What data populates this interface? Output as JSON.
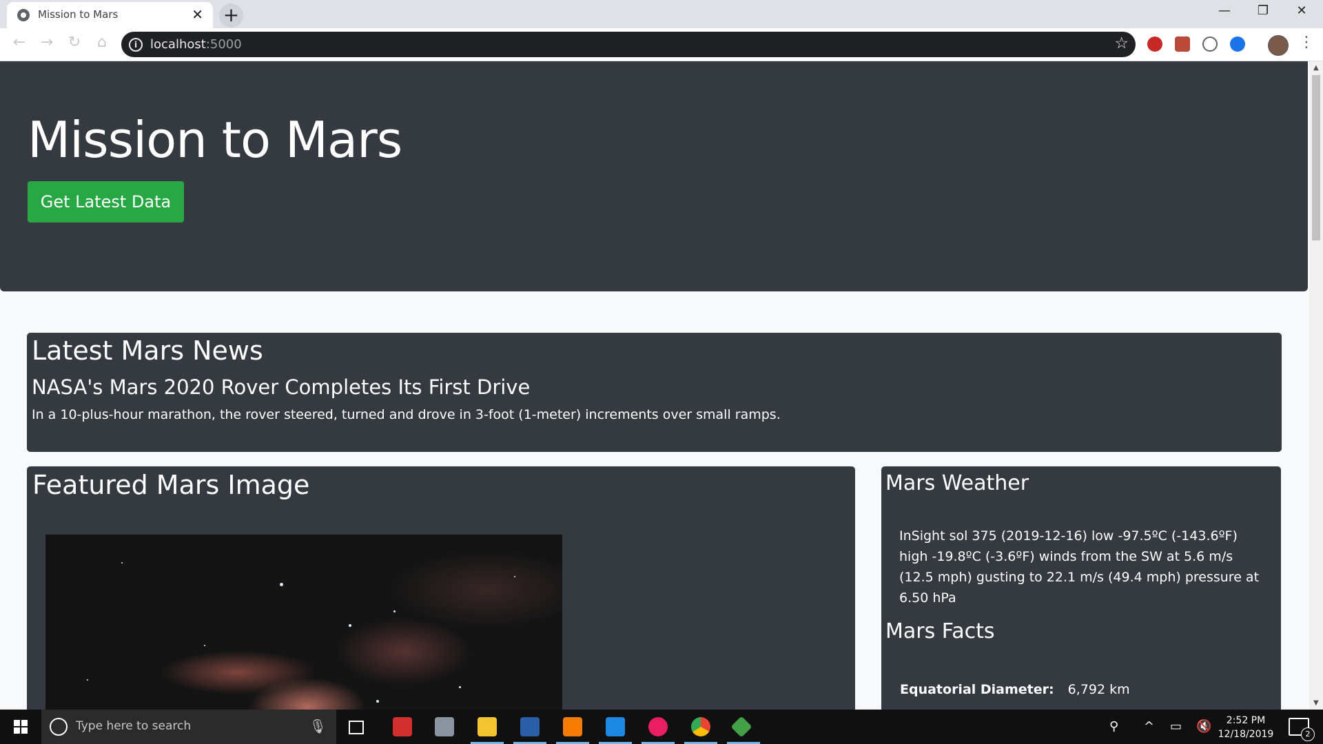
{
  "browser": {
    "tab_title": "Mission to Mars",
    "url_host": "localhost",
    "url_port": ":5000"
  },
  "page": {
    "title": "Mission to Mars",
    "get_data_button": "Get Latest Data",
    "news": {
      "heading": "Latest Mars News",
      "headline": "NASA's Mars 2020 Rover Completes Its First Drive",
      "teaser": "In a 10-plus-hour marathon, the rover steered, turned and drove in 3-foot (1-meter) increments over small ramps."
    },
    "featured": {
      "heading": "Featured Mars Image"
    },
    "weather": {
      "heading": "Mars Weather",
      "report": "InSight sol 375 (2019-12-16) low -97.5ºC (-143.6ºF) high -19.8ºC (-3.6ºF) winds from the SW at 5.6 m/s (12.5 mph) gusting to 22.1 m/s (49.4 mph) pressure at 6.50 hPa"
    },
    "facts": {
      "heading": "Mars Facts",
      "rows": [
        {
          "label": "Equatorial Diameter:",
          "value": "6,792 km"
        }
      ]
    }
  },
  "taskbar": {
    "search_placeholder": "Type here to search",
    "time": "2:52 PM",
    "date": "12/18/2019",
    "notification_count": "2"
  },
  "colors": {
    "jumbotron": "#343a40",
    "button_green": "#28a745",
    "page_bg": "#f8f9fa",
    "taskbar": "#101010"
  }
}
